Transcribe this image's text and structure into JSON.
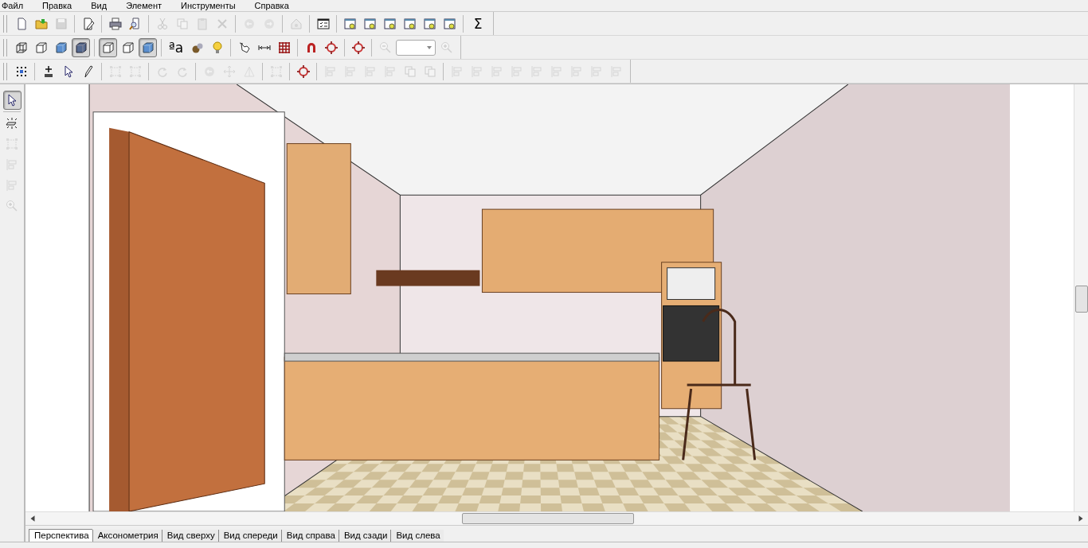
{
  "menu": [
    "Файл",
    "Правка",
    "Вид",
    "Элемент",
    "Инструменты",
    "Справка"
  ],
  "toolbars": [
    {
      "buttons": [
        {
          "kind": "page",
          "disabled": false,
          "pressed": false
        },
        {
          "kind": "folder",
          "disabled": false,
          "pressed": false
        },
        {
          "kind": "disk",
          "disabled": true,
          "pressed": false
        },
        {
          "kind": "sep"
        },
        {
          "kind": "edit-doc",
          "disabled": false,
          "pressed": false
        },
        {
          "kind": "sep"
        },
        {
          "kind": "printer",
          "disabled": false,
          "pressed": false
        },
        {
          "kind": "preview",
          "disabled": false,
          "pressed": false
        },
        {
          "kind": "sep"
        },
        {
          "kind": "scissors",
          "disabled": true,
          "pressed": false
        },
        {
          "kind": "copy",
          "disabled": true,
          "pressed": false
        },
        {
          "kind": "paste",
          "disabled": true,
          "pressed": false
        },
        {
          "kind": "cross",
          "disabled": true,
          "pressed": false
        },
        {
          "kind": "sep"
        },
        {
          "kind": "undo",
          "disabled": true,
          "pressed": false
        },
        {
          "kind": "redo",
          "disabled": true,
          "pressed": false
        },
        {
          "kind": "sep"
        },
        {
          "kind": "gear",
          "disabled": true,
          "pressed": false
        },
        {
          "kind": "sep"
        },
        {
          "kind": "checklist",
          "disabled": false,
          "pressed": false
        },
        {
          "kind": "sep"
        },
        {
          "kind": "window",
          "disabled": false,
          "pressed": false
        },
        {
          "kind": "window",
          "disabled": false,
          "pressed": false
        },
        {
          "kind": "window",
          "disabled": false,
          "pressed": false
        },
        {
          "kind": "window",
          "disabled": false,
          "pressed": false
        },
        {
          "kind": "window",
          "disabled": false,
          "pressed": false
        },
        {
          "kind": "window",
          "disabled": false,
          "pressed": false
        },
        {
          "kind": "sep"
        },
        {
          "kind": "text",
          "label": "Σ",
          "disabled": false,
          "pressed": false
        }
      ]
    },
    {
      "buttons": [
        {
          "kind": "cube-wire",
          "disabled": false,
          "pressed": false
        },
        {
          "kind": "cube-white",
          "disabled": false,
          "pressed": false
        },
        {
          "kind": "cube-blue",
          "disabled": false,
          "pressed": false
        },
        {
          "kind": "cube-dark",
          "disabled": false,
          "pressed": true
        },
        {
          "kind": "sep"
        },
        {
          "kind": "cube-white",
          "disabled": false,
          "pressed": true
        },
        {
          "kind": "cube-white",
          "disabled": false,
          "pressed": false
        },
        {
          "kind": "cube-blue",
          "disabled": false,
          "pressed": true
        },
        {
          "kind": "sep"
        },
        {
          "kind": "text",
          "label": "ªa",
          "disabled": false,
          "pressed": false
        },
        {
          "kind": "spheres",
          "disabled": false,
          "pressed": false
        },
        {
          "kind": "bulb",
          "disabled": false,
          "pressed": false
        },
        {
          "kind": "sep"
        },
        {
          "kind": "hand",
          "disabled": false,
          "pressed": false
        },
        {
          "kind": "ruler",
          "disabled": false,
          "pressed": false
        },
        {
          "kind": "grid",
          "disabled": false,
          "pressed": false
        },
        {
          "kind": "sep"
        },
        {
          "kind": "magnet",
          "disabled": false,
          "pressed": false
        },
        {
          "kind": "target",
          "disabled": false,
          "pressed": false
        },
        {
          "kind": "sep"
        },
        {
          "kind": "target",
          "disabled": false,
          "pressed": false
        },
        {
          "kind": "sep"
        },
        {
          "kind": "zoom-out",
          "disabled": true,
          "pressed": false
        },
        {
          "kind": "combo"
        },
        {
          "kind": "zoom-in",
          "disabled": true,
          "pressed": false
        }
      ]
    },
    {
      "buttons": [
        {
          "kind": "dots",
          "disabled": false,
          "pressed": false
        },
        {
          "kind": "sep"
        },
        {
          "kind": "plus",
          "disabled": false,
          "pressed": false
        },
        {
          "kind": "pointer",
          "disabled": false,
          "pressed": false
        },
        {
          "kind": "pen",
          "disabled": false,
          "pressed": false
        },
        {
          "kind": "sep"
        },
        {
          "kind": "frame",
          "disabled": true,
          "pressed": false
        },
        {
          "kind": "frame",
          "disabled": true,
          "pressed": false
        },
        {
          "kind": "sep"
        },
        {
          "kind": "rotate",
          "disabled": true,
          "pressed": false
        },
        {
          "kind": "rotate",
          "disabled": true,
          "pressed": false
        },
        {
          "kind": "sep"
        },
        {
          "kind": "undo",
          "disabled": true,
          "pressed": false
        },
        {
          "kind": "move",
          "disabled": true,
          "pressed": false
        },
        {
          "kind": "mirror",
          "disabled": true,
          "pressed": false
        },
        {
          "kind": "sep"
        },
        {
          "kind": "frame",
          "disabled": true,
          "pressed": false
        },
        {
          "kind": "sep"
        },
        {
          "kind": "target",
          "disabled": false,
          "pressed": false
        },
        {
          "kind": "sep"
        },
        {
          "kind": "align",
          "disabled": true,
          "pressed": false
        },
        {
          "kind": "align",
          "disabled": true,
          "pressed": false
        },
        {
          "kind": "align",
          "disabled": true,
          "pressed": false
        },
        {
          "kind": "align",
          "disabled": true,
          "pressed": false
        },
        {
          "kind": "copy",
          "disabled": true,
          "pressed": false
        },
        {
          "kind": "copy",
          "disabled": true,
          "pressed": false
        },
        {
          "kind": "sep"
        },
        {
          "kind": "align",
          "disabled": true,
          "pressed": false
        },
        {
          "kind": "align",
          "disabled": true,
          "pressed": false
        },
        {
          "kind": "align",
          "disabled": true,
          "pressed": false
        },
        {
          "kind": "align",
          "disabled": true,
          "pressed": false
        },
        {
          "kind": "align",
          "disabled": true,
          "pressed": false
        },
        {
          "kind": "align",
          "disabled": true,
          "pressed": false
        },
        {
          "kind": "align",
          "disabled": true,
          "pressed": false
        },
        {
          "kind": "align",
          "disabled": true,
          "pressed": false
        },
        {
          "kind": "align",
          "disabled": true,
          "pressed": false
        }
      ]
    }
  ],
  "left_toolbar": [
    {
      "kind": "pointer",
      "disabled": false,
      "pressed": true
    },
    {
      "kind": "sep"
    },
    {
      "kind": "light",
      "disabled": false,
      "pressed": false
    },
    {
      "kind": "frame",
      "disabled": true,
      "pressed": false
    },
    {
      "kind": "align",
      "disabled": true,
      "pressed": false
    },
    {
      "kind": "align",
      "disabled": true,
      "pressed": false
    },
    {
      "kind": "zoom-in",
      "disabled": true,
      "pressed": false
    }
  ],
  "view_tabs": [
    {
      "label": "Перспектива",
      "selected": true
    },
    {
      "label": "Аксонометрия",
      "selected": false
    },
    {
      "label": "Вид сверху",
      "selected": false
    },
    {
      "label": "Вид спереди",
      "selected": false
    },
    {
      "label": "Вид справа",
      "selected": false
    },
    {
      "label": "Вид сзади",
      "selected": false
    },
    {
      "label": "Вид слева",
      "selected": false
    }
  ]
}
